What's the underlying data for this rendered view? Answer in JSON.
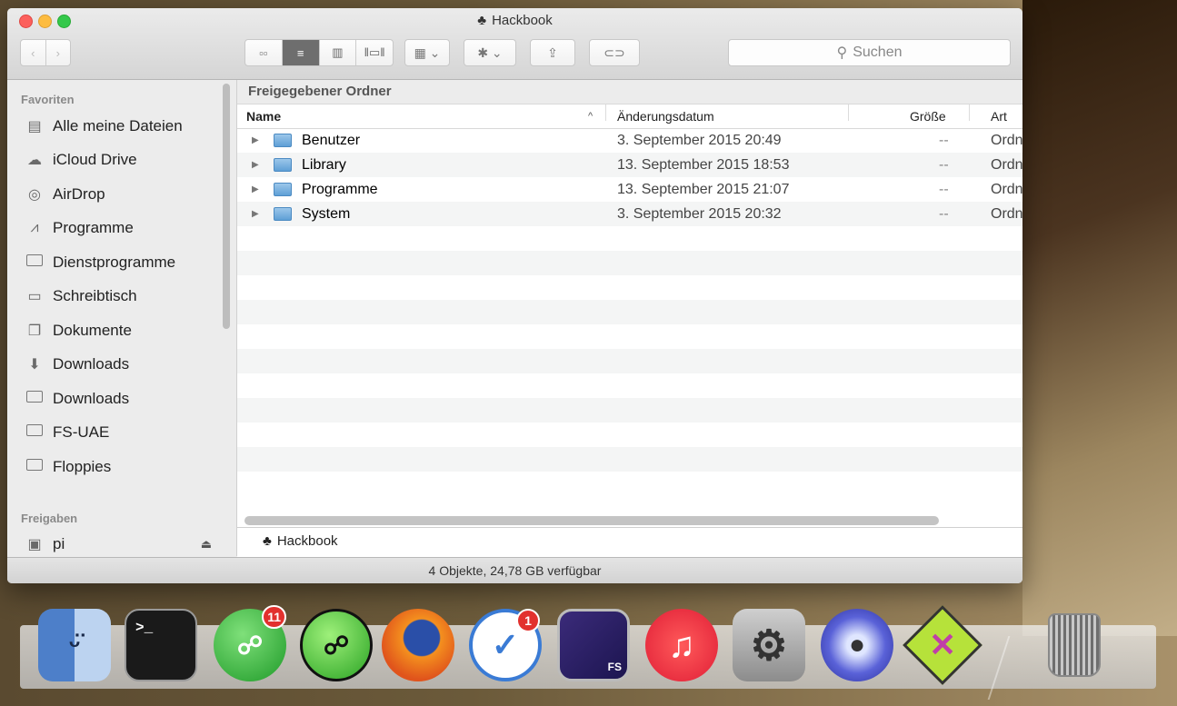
{
  "window": {
    "title": "Hackbook",
    "search_placeholder": "Suchen",
    "path_header": "Freigegebener Ordner",
    "pathbar_label": "Hackbook",
    "status": "4 Objekte, 24,78 GB verfügbar"
  },
  "toolbar": {
    "back_icon": "chevron-left",
    "forward_icon": "chevron-right",
    "views": [
      "icon-view",
      "list-view",
      "column-view",
      "coverflow-view"
    ],
    "active_view": "list-view"
  },
  "sidebar": {
    "favorites_heading": "Favoriten",
    "favorites": [
      {
        "label": "Alle meine Dateien",
        "icon": "all-files-icon"
      },
      {
        "label": "iCloud Drive",
        "icon": "cloud-icon"
      },
      {
        "label": "AirDrop",
        "icon": "airdrop-icon"
      },
      {
        "label": "Programme",
        "icon": "applications-icon"
      },
      {
        "label": "Dienstprogramme",
        "icon": "folder-icon"
      },
      {
        "label": "Schreibtisch",
        "icon": "desktop-icon"
      },
      {
        "label": "Dokumente",
        "icon": "documents-icon"
      },
      {
        "label": "Downloads",
        "icon": "downloads-icon"
      },
      {
        "label": "Downloads",
        "icon": "folder-icon"
      },
      {
        "label": "FS-UAE",
        "icon": "folder-icon"
      },
      {
        "label": "Floppies",
        "icon": "folder-icon"
      }
    ],
    "shared_heading": "Freigaben",
    "shared": [
      {
        "label": "pi",
        "icon": "display-icon"
      }
    ]
  },
  "columns": {
    "name": "Name",
    "date": "Änderungsdatum",
    "size": "Größe",
    "kind": "Art"
  },
  "files": [
    {
      "name": "Benutzer",
      "date": "3. September 2015 20:49",
      "size": "--",
      "kind": "Ordner"
    },
    {
      "name": "Library",
      "date": "13. September 2015 18:53",
      "size": "--",
      "kind": "Ordner"
    },
    {
      "name": "Programme",
      "date": "13. September 2015 21:07",
      "size": "--",
      "kind": "Ordner"
    },
    {
      "name": "System",
      "date": "3. September 2015 20:32",
      "size": "--",
      "kind": "Ordner"
    }
  ],
  "dock": [
    {
      "name": "finder",
      "badge": ""
    },
    {
      "name": "terminal",
      "badge": ""
    },
    {
      "name": "app-green-1",
      "badge": "11"
    },
    {
      "name": "app-green-2",
      "badge": ""
    },
    {
      "name": "firefox",
      "badge": ""
    },
    {
      "name": "airmail",
      "badge": "1"
    },
    {
      "name": "fs-uae",
      "badge": ""
    },
    {
      "name": "itunes",
      "badge": ""
    },
    {
      "name": "system-preferences",
      "badge": ""
    },
    {
      "name": "app-blue",
      "badge": ""
    },
    {
      "name": "app-x",
      "badge": ""
    },
    {
      "name": "trash",
      "badge": ""
    }
  ],
  "terminal_prompt": ">_",
  "fs_label": "FS"
}
